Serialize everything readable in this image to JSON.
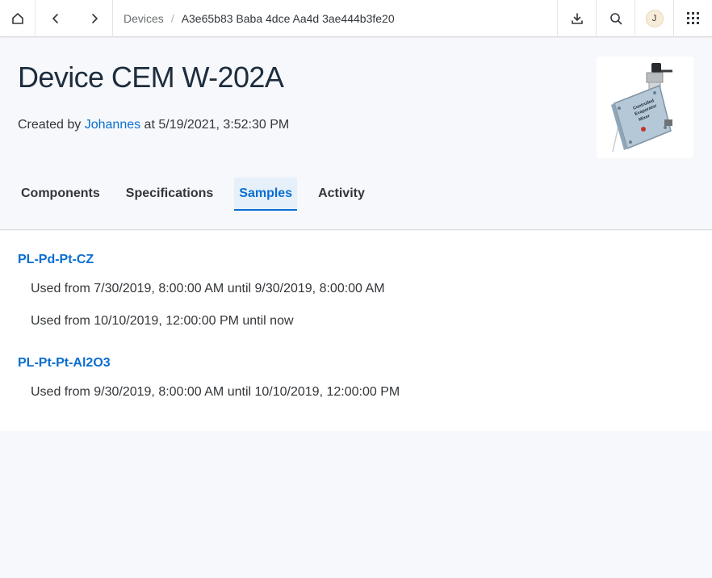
{
  "shellbar": {
    "breadcrumb_root": "Devices",
    "breadcrumb_separator": "/",
    "breadcrumb_current": "A3e65b83 Baba 4dce Aa4d 3ae444b3fe20",
    "avatar_initial": "J"
  },
  "header": {
    "title": "Device CEM W-202A",
    "created_prefix": "Created by ",
    "created_by": "Johannes",
    "created_suffix": " at 5/19/2021, 3:52:30 PM",
    "image_label_lines": [
      "Controlled",
      "Evaporator",
      "Mixer"
    ]
  },
  "tabs": [
    {
      "label": "Components",
      "active": false
    },
    {
      "label": "Specifications",
      "active": false
    },
    {
      "label": "Samples",
      "active": true
    },
    {
      "label": "Activity",
      "active": false
    }
  ],
  "samples": [
    {
      "name": "PL-Pd-Pt-CZ",
      "usages": [
        "Used from 7/30/2019, 8:00:00 AM until 9/30/2019, 8:00:00 AM",
        "Used from 10/10/2019, 12:00:00 PM until now"
      ]
    },
    {
      "name": "PL-Pt-Pt-Al2O3",
      "usages": [
        "Used from 9/30/2019, 8:00:00 AM until 10/10/2019, 12:00:00 PM"
      ]
    }
  ]
}
